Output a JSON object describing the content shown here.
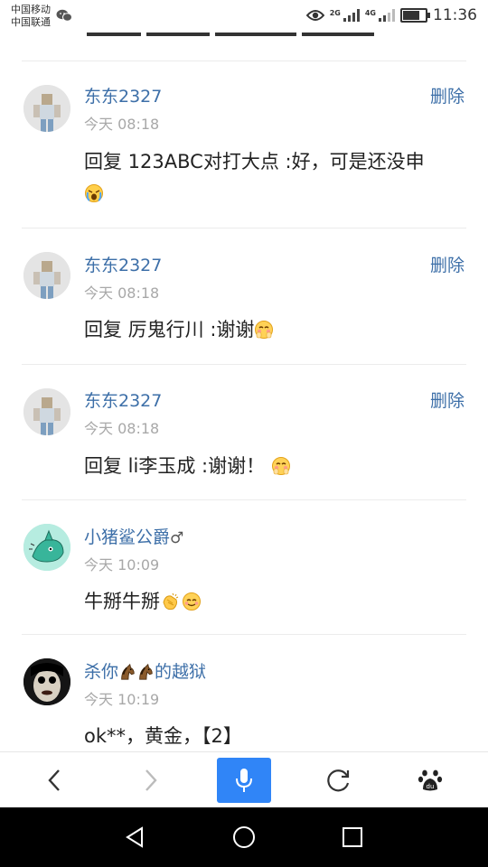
{
  "status_bar": {
    "carriers": [
      "中国移动",
      "中国联通"
    ],
    "network_labels": [
      "2G",
      "4G"
    ],
    "time": "11:36",
    "battery_level": 0.75
  },
  "comments": [
    {
      "username": "东东2327",
      "time": "今天 08:18",
      "delete_label": "删除",
      "text": "回复 123ABC对打大点 :好，可是还没申",
      "emojis_line2": [
        "crying-face"
      ]
    },
    {
      "username": "东东2327",
      "time": "今天 08:18",
      "delete_label": "删除",
      "text": "回复 厉鬼行川 :谢谢",
      "emojis": [
        "blushing-face"
      ]
    },
    {
      "username": "东东2327",
      "time": "今天 08:18",
      "delete_label": "删除",
      "text": "回复 li李玉成 :谢谢！",
      "emojis": [
        "blushing-face"
      ]
    },
    {
      "username": "小猪鲨公爵",
      "gender_symbol": "♂",
      "time": "今天 10:09",
      "text": "牛掰牛掰",
      "emojis": [
        "clapping-hands",
        "smiling-face"
      ]
    },
    {
      "username_parts": [
        "杀你",
        "的越狱"
      ],
      "username_emojis": [
        "horse",
        "horse"
      ],
      "time": "今天 10:19",
      "text": "ok**，黄金，【2】"
    }
  ],
  "toolbar": {
    "icons": [
      "back-icon",
      "forward-icon",
      "microphone-icon",
      "refresh-icon",
      "baidu-paw-icon"
    ],
    "accent_color": "#3085f7"
  },
  "nav_bar": {
    "icons": [
      "back-triangle-icon",
      "home-circle-icon",
      "recents-square-icon"
    ]
  },
  "colors": {
    "username": "#3d6fa8",
    "timestamp": "#a8a8a8"
  }
}
